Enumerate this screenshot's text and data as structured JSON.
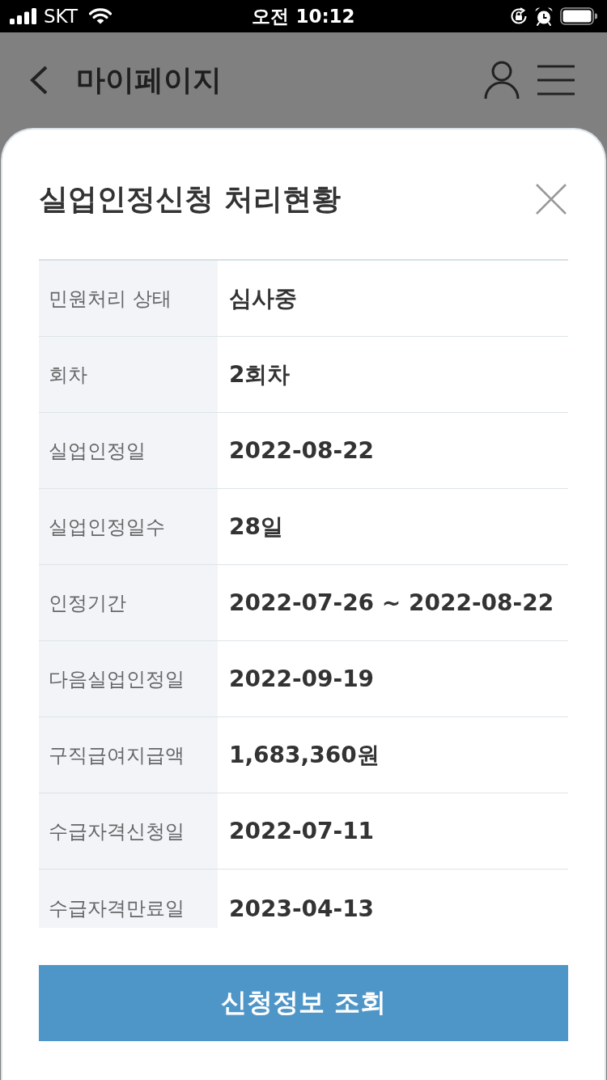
{
  "status_bar": {
    "carrier": "SKT",
    "time": "오전 10:12"
  },
  "header": {
    "title": "마이페이지"
  },
  "modal": {
    "title": "실업인정신청 처리현황",
    "rows": [
      {
        "label": "민원처리 상태",
        "value": "심사중"
      },
      {
        "label": "회차",
        "value": "2회차"
      },
      {
        "label": "실업인정일",
        "value": "2022-08-22"
      },
      {
        "label": "실업인정일수",
        "value": "28일"
      },
      {
        "label": "인정기간",
        "value": "2022-07-26 ~ 2022-08-22"
      },
      {
        "label": "다음실업인정일",
        "value": "2022-09-19"
      },
      {
        "label": "구직급여지급액",
        "value": "1,683,360원"
      },
      {
        "label": "수급자격신청일",
        "value": "2022-07-11"
      },
      {
        "label": "수급자격만료일",
        "value": "2023-04-13"
      }
    ],
    "button": "신청정보 조회"
  }
}
